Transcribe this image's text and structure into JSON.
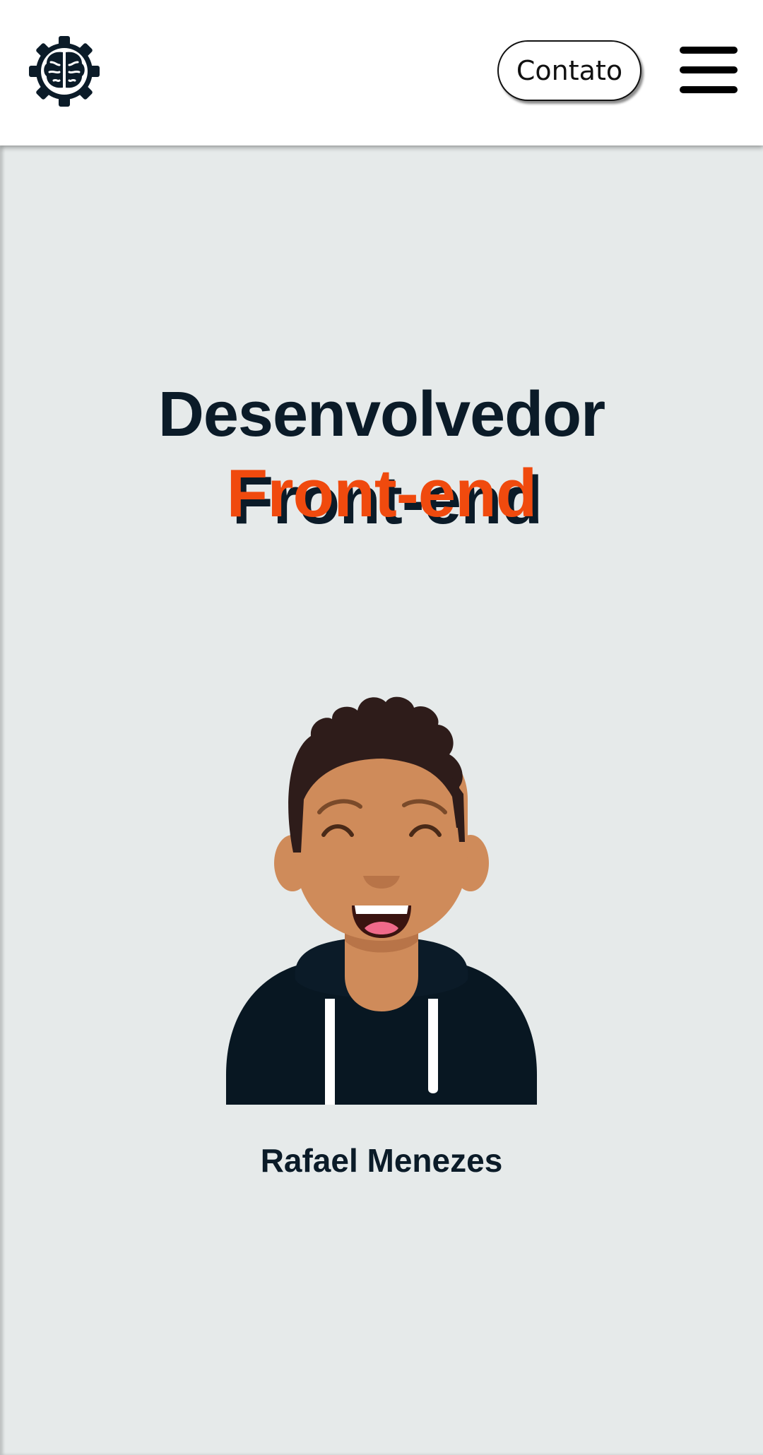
{
  "header": {
    "logo_icon": "brain-gear-icon",
    "contact_label": "Contato",
    "menu_icon": "hamburger-menu-icon"
  },
  "hero": {
    "title_line1": "Desenvolvedor",
    "title_line2": "Front-end",
    "avatar_icon": "smiling-man-avatar-illustration",
    "name": "Rafael Menezes"
  },
  "colors": {
    "background": "#e6eaea",
    "header": "#ffffff",
    "dark": "#0b1b28",
    "accent": "#f04a0e",
    "skin": "#cf8b5a",
    "hair": "#2e1c1a"
  }
}
